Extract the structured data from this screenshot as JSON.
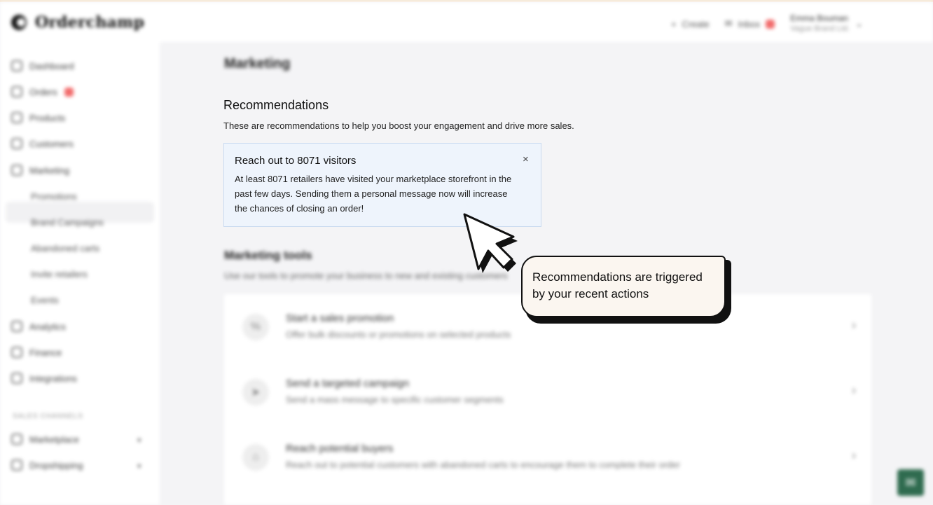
{
  "header": {
    "logo_text": "Orderchamp",
    "create_label": "Create",
    "inbox_label": "Inbox",
    "user_name": "Emma Bouman",
    "user_sub": "Vague Brand Ltd."
  },
  "sidebar": {
    "items": [
      {
        "label": "Dashboard",
        "icon": "home-icon"
      },
      {
        "label": "Orders",
        "icon": "orders-icon"
      },
      {
        "label": "Products",
        "icon": "tag-icon"
      },
      {
        "label": "Customers",
        "icon": "customers-icon"
      },
      {
        "label": "Marketing",
        "icon": "megaphone-icon"
      }
    ],
    "sub_items": [
      "Promotions",
      "Brand Campaigns",
      "Abandoned carts",
      "Invite retailers",
      "Events"
    ],
    "more_items": [
      {
        "label": "Analytics",
        "icon": "analytics-icon"
      },
      {
        "label": "Finance",
        "icon": "finance-icon"
      },
      {
        "label": "Integrations",
        "icon": "integrations-icon"
      }
    ],
    "section_label": "SALES CHANNELS",
    "channels": [
      {
        "label": "Marketplace",
        "icon": "store-icon"
      },
      {
        "label": "Dropshipping",
        "icon": "box-icon"
      }
    ]
  },
  "main": {
    "page_title": "Marketing",
    "recommendations": {
      "title": "Recommendations",
      "subtitle": "These are recommendations to help you boost your engagement and drive more sales.",
      "card_title": "Reach out to 8071 visitors",
      "card_body": "At least 8071 retailers have visited your marketplace storefront in the past few days. Sending them a personal message now will increase the chances of closing an order!",
      "close_glyph": "×"
    },
    "tools": {
      "title": "Marketing tools",
      "subtitle": "Use our tools to promote your business to new and existing customers",
      "rows": [
        {
          "title": "Start a sales promotion",
          "desc": "Offer bulk discounts or promotions on selected products",
          "icon": "percent-icon"
        },
        {
          "title": "Send a targeted campaign",
          "desc": "Send a mass message to specific customer segments",
          "icon": "send-icon"
        },
        {
          "title": "Reach potential buyers",
          "desc": "Reach out to potential customers with abandoned carts to encourage them to complete their order",
          "icon": "cart-icon"
        }
      ]
    }
  },
  "callout": {
    "text": "Recommendations are triggered by your recent actions"
  }
}
